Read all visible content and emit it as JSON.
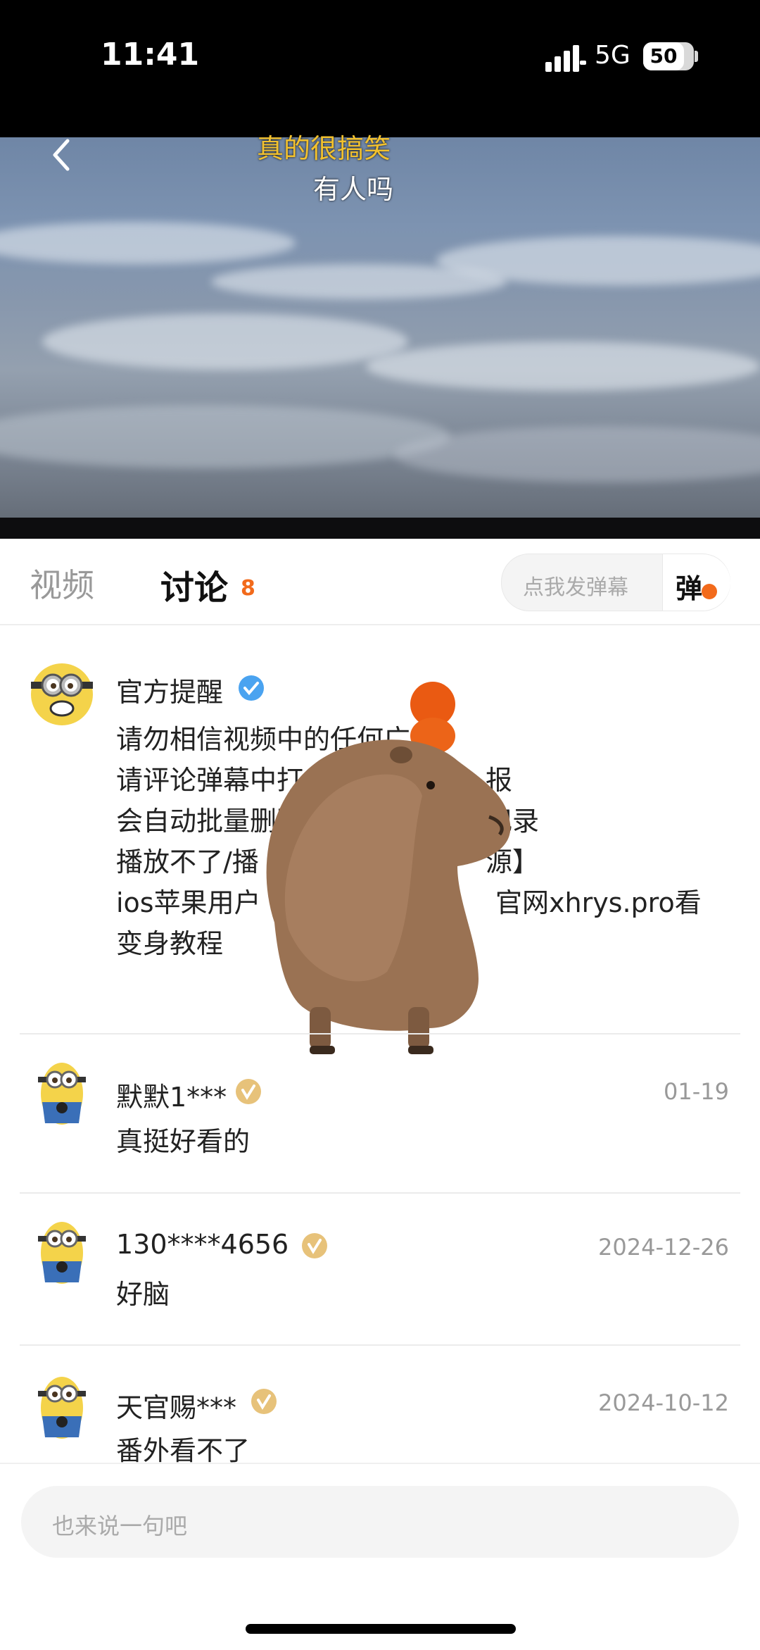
{
  "status_bar": {
    "time": "11:41",
    "network": "5G",
    "battery": "50"
  },
  "video": {
    "danmaku": [
      "真的很搞笑",
      "有人吗"
    ]
  },
  "tabs": {
    "video_label": "视频",
    "discuss_label": "讨论",
    "discuss_count": "8"
  },
  "danmu_input": {
    "placeholder": "点我发弹幕",
    "send_label": "弹"
  },
  "comments": [
    {
      "name": "官方提醒",
      "date": "",
      "lines": [
        "请勿相信视频中的任何广",
        "请评论弹幕中打广告",
        "报",
        "会自动批量删除",
        "记录",
        "播放不了/播",
        "源】",
        "ios苹果用户",
        "官网xhrys.pro看",
        "变身教程"
      ]
    },
    {
      "name": "默默1***",
      "date": "01-19",
      "text": "真挺好看的"
    },
    {
      "name": "130****4656",
      "date": "2024-12-26",
      "text": "好脑"
    },
    {
      "name": "天官赐***",
      "date": "2024-10-12",
      "text": "番外看不了"
    }
  ],
  "bottom_input": {
    "placeholder": "也来说一句吧"
  },
  "colors": {
    "accent": "#f26a1b",
    "verify_blue": "#4aa3f0",
    "verify_gold": "#e7c27a"
  }
}
